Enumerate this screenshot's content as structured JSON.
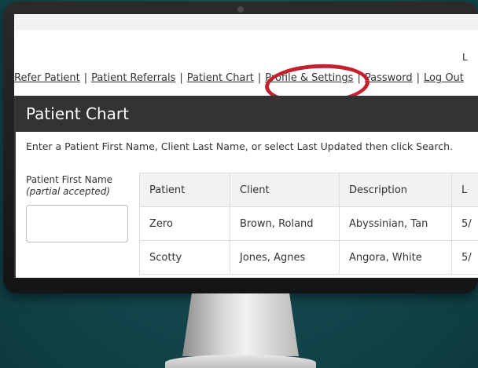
{
  "login_fragment": "L",
  "nav": {
    "items": [
      {
        "label": "Refer Patient"
      },
      {
        "label": "Patient Referrals"
      },
      {
        "label": "Patient Chart"
      },
      {
        "label": "Profile & Settings"
      },
      {
        "label": "Password"
      },
      {
        "label": "Log Out"
      }
    ],
    "separator": "|"
  },
  "highlight_color": "#c4202e",
  "panel": {
    "title": "Patient Chart",
    "instruction": "Enter a Patient First Name, Client Last Name, or select Last Updated then click Search."
  },
  "search": {
    "first_name_label": "Patient First Name",
    "first_name_hint": "(partial accepted)",
    "first_name_value": ""
  },
  "table": {
    "headers": [
      "Patient",
      "Client",
      "Description",
      "L"
    ],
    "rows": [
      [
        "Zero",
        "Brown, Roland",
        "Abyssinian, Tan",
        "5/"
      ],
      [
        "Scotty",
        "Jones, Agnes",
        "Angora, White",
        "5/"
      ]
    ]
  }
}
